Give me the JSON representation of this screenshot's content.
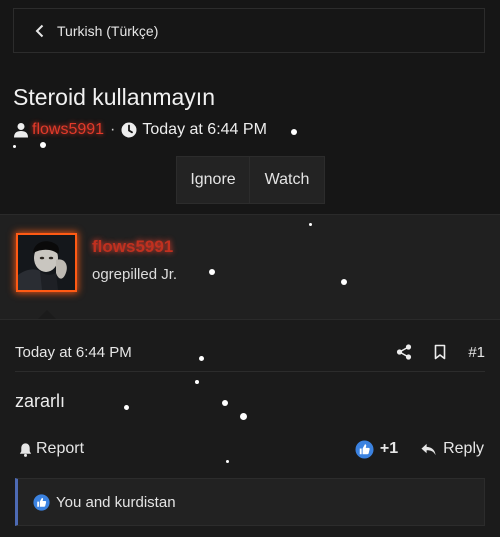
{
  "breadcrumb": {
    "label": "Turkish (Türkçe)"
  },
  "thread": {
    "title": "Steroid kullanmayın",
    "author": "flows5991",
    "separator": "·",
    "date": "Today at 6:44 PM"
  },
  "actions": {
    "ignore": "Ignore",
    "watch": "Watch"
  },
  "post": {
    "username": "flows5991",
    "user_title": "ogrepilled Jr.",
    "date": "Today at 6:44 PM",
    "number": "#1",
    "body": "zararlı",
    "report_label": "Report",
    "likes_count": "+1",
    "reply_label": "Reply",
    "likes_text": "You and kurdistan"
  },
  "colors": {
    "background": "#161616",
    "username_glow": "#e23a2a",
    "avatar_border": "#ff5a14",
    "like_blue": "#3b82e0",
    "quote_bar": "#4d6ab4"
  },
  "icons": {
    "back": "chevron-left-icon",
    "user": "user-icon",
    "clock": "clock-icon",
    "share": "share-icon",
    "bookmark": "bookmark-icon",
    "bell": "bell-icon",
    "like": "thumbs-up-icon",
    "reply": "reply-icon"
  }
}
